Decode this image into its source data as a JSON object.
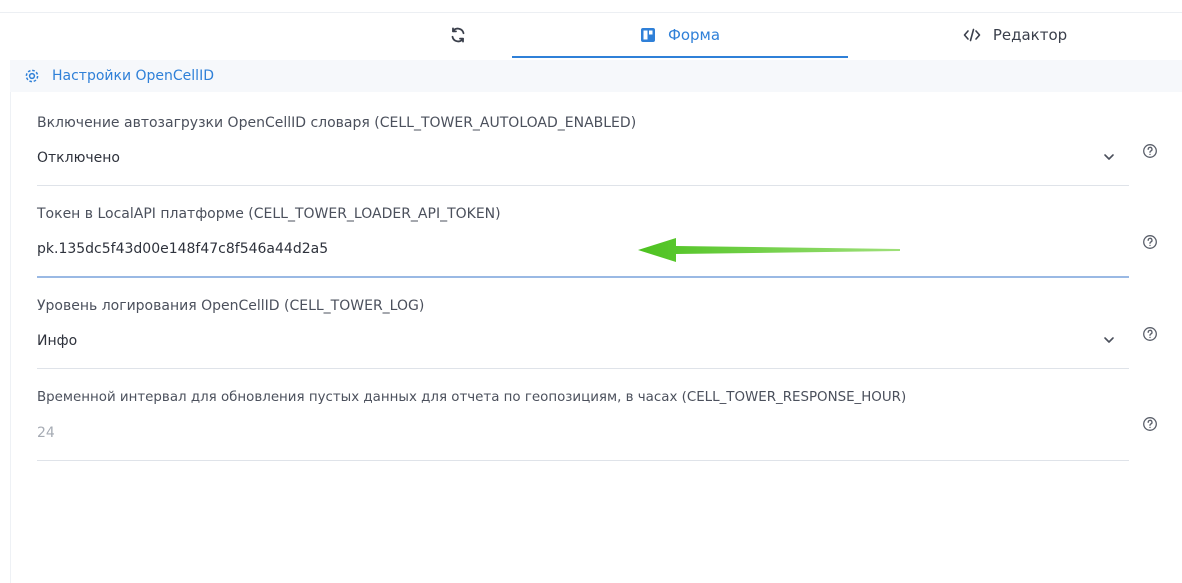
{
  "tabs": [
    {
      "id": "refresh",
      "label": "",
      "icon": "refresh-icon"
    },
    {
      "id": "form",
      "label": "Форма",
      "icon": "form-icon",
      "active": true
    },
    {
      "id": "editor",
      "label": "Редактор",
      "icon": "code-icon"
    }
  ],
  "section": {
    "title": "Настройки OpenCellID",
    "icon": "gear-icon"
  },
  "fields": [
    {
      "label": "Включение автозагрузки OpenCellID словаря (CELL_TOWER_AUTOLOAD_ENABLED)",
      "value": "Отключено",
      "type": "select"
    },
    {
      "label": "Токен в LocalAPI платформе (CELL_TOWER_LOADER_API_TOKEN)",
      "value": "pk.135dc5f43d00e148f47c8f546a44d2a5",
      "type": "text"
    },
    {
      "label": "Уровень логирования OpenCellID (CELL_TOWER_LOG)",
      "value": "Инфо",
      "type": "select"
    },
    {
      "label": "Временной интервал для обновления пустых данных для отчета по геопозициям, в часах (CELL_TOWER_RESPONSE_HOUR)",
      "placeholder": "24",
      "type": "number"
    }
  ],
  "colors": {
    "accent": "#2f80d8",
    "arrow": "#4cc21f"
  }
}
